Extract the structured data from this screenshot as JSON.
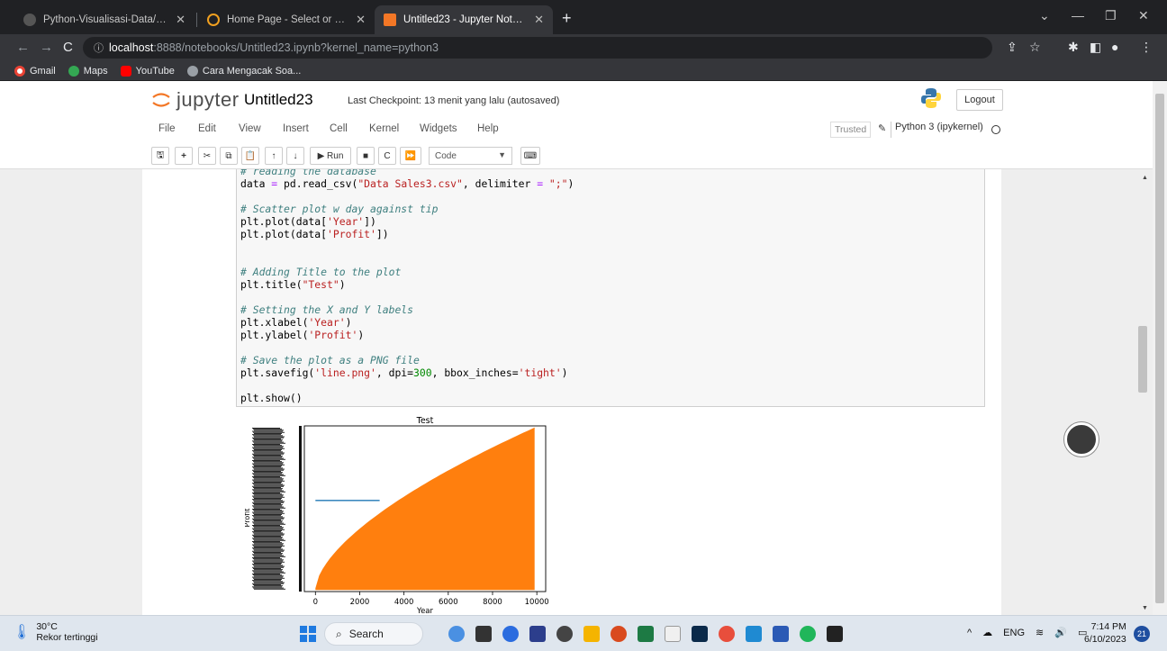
{
  "browser": {
    "tabs": [
      {
        "label": "Python-Visualisasi-Data/Data Vis",
        "active": false
      },
      {
        "label": "Home Page - Select or create a n",
        "active": false
      },
      {
        "label": "Untitled23 - Jupyter Notebook",
        "active": true
      }
    ],
    "url_host": "localhost",
    "url_path": ":8888/notebooks/Untitled23.ipynb?kernel_name=python3",
    "bookmarks": [
      "Gmail",
      "Maps",
      "YouTube",
      "Cara Mengacak Soa..."
    ]
  },
  "jupyter": {
    "logo_text": "jupyter",
    "notebook_name": "Untitled23",
    "checkpoint": "Last Checkpoint: 13 menit yang lalu  (autosaved)",
    "logout_label": "Logout",
    "menu": [
      "File",
      "Edit",
      "View",
      "Insert",
      "Cell",
      "Kernel",
      "Widgets",
      "Help"
    ],
    "trusted_label": "Trusted",
    "kernel_label": "Python 3 (ipykernel)",
    "run_label": "Run",
    "cell_type": "Code"
  },
  "code_lines": [
    "# reading the database",
    "data = pd.read_csv(\"Data Sales3.csv\", delimiter = \";\")",
    "",
    "# Scatter plot w day against tip",
    "plt.plot(data['Year'])",
    "plt.plot(data['Profit'])",
    "",
    "",
    "# Adding Title to the plot",
    "plt.title(\"Test\")",
    "",
    "# Setting the X and Y labels",
    "plt.xlabel('Year')",
    "plt.ylabel('Profit')",
    "",
    "# Save the plot as a PNG file",
    "plt.savefig('line.png', dpi=300, bbox_inches='tight')",
    "",
    "plt.show()"
  ],
  "chart_data": {
    "type": "line",
    "title": "Test",
    "xlabel": "Year",
    "ylabel": "Profit",
    "xlim": [
      -500,
      10400
    ],
    "xticks": [
      0,
      2000,
      4000,
      6000,
      8000,
      10000
    ],
    "series": [
      {
        "color": "#1f77b4",
        "description": "flat line",
        "x": [
          0,
          2900
        ],
        "y_level": 0.55
      },
      {
        "color": "#ff7f0e",
        "description": "filled growing envelope",
        "x": [
          0,
          9900
        ],
        "y_top": [
          0.02,
          0.99
        ]
      }
    ]
  },
  "taskbar": {
    "temperature": "30°C",
    "weather_text": "Rekor tertinggi",
    "search_label": "Search",
    "tray_lang": "ENG",
    "time": "7:14 PM",
    "date": "6/10/2023",
    "notif_count": "21"
  }
}
